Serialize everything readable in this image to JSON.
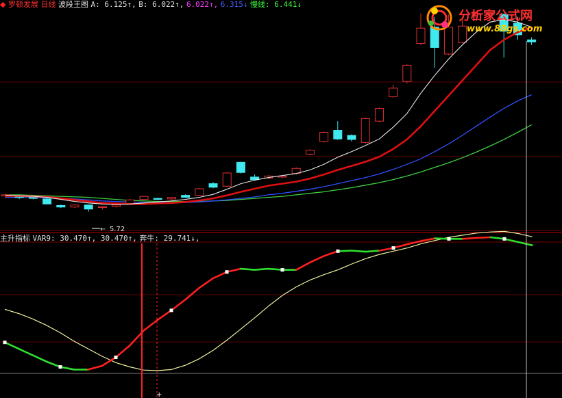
{
  "header_top": {
    "stock": "罗顿发展",
    "period": "日线",
    "indicator": "波段王图",
    "a_text": "A: 6.125↑,",
    "b_text": "B: 6.022↑,",
    "c_text": "6.022↑,",
    "d_text": "6.315↓",
    "slow_label": "慢线: 6.441↓",
    "colors": {
      "stock": "#ff3030",
      "period": "#ff3030",
      "indicator": "#e0e0e0",
      "a": "#e0e0e0",
      "b": "#e0e0e0",
      "c": "#ff40ff",
      "d": "#4060ff",
      "slow": "#40ff40"
    }
  },
  "header_bottom": {
    "title": "主升指标",
    "var9_label": "VAR9: 30.470↑, 30.470↑,",
    "bull_label": "奔牛: 29.741↓,",
    "colors": {
      "title": "#e0e0e0",
      "var9": "#e0e0e0",
      "bull": "#e0e0e0"
    }
  },
  "logo": {
    "text": "分析家公式网",
    "url_text": "www.88gs.com"
  },
  "price_low_label": "5.72",
  "chart_data": [
    {
      "type": "candlestick",
      "title": "波段王图",
      "candles": [
        {
          "o": 6.03,
          "c": 6.05,
          "h": 6.08,
          "l": 5.98,
          "up": true
        },
        {
          "o": 6.01,
          "c": 6.0,
          "h": 6.03,
          "l": 5.97,
          "up": false
        },
        {
          "o": 6.02,
          "c": 5.98,
          "h": 6.03,
          "l": 5.96,
          "up": false
        },
        {
          "o": 5.97,
          "c": 5.87,
          "h": 5.98,
          "l": 5.86,
          "up": false
        },
        {
          "o": 5.84,
          "c": 5.81,
          "h": 5.86,
          "l": 5.79,
          "up": false
        },
        {
          "o": 5.81,
          "c": 5.85,
          "h": 5.86,
          "l": 5.79,
          "up": true
        },
        {
          "o": 5.85,
          "c": 5.77,
          "h": 5.86,
          "l": 5.72,
          "up": false
        },
        {
          "o": 5.8,
          "c": 5.82,
          "h": 5.83,
          "l": 5.76,
          "up": true
        },
        {
          "o": 5.82,
          "c": 5.85,
          "h": 5.86,
          "l": 5.8,
          "up": true
        },
        {
          "o": 5.88,
          "c": 5.95,
          "h": 5.97,
          "l": 5.86,
          "up": true
        },
        {
          "o": 5.96,
          "c": 6.02,
          "h": 6.03,
          "l": 5.95,
          "up": true
        },
        {
          "o": 5.98,
          "c": 5.96,
          "h": 5.99,
          "l": 5.94,
          "up": false
        },
        {
          "o": 5.97,
          "c": 6.0,
          "h": 6.01,
          "l": 5.95,
          "up": true
        },
        {
          "o": 6.04,
          "c": 6.0,
          "h": 6.06,
          "l": 5.99,
          "up": false
        },
        {
          "o": 6.04,
          "c": 6.17,
          "h": 6.18,
          "l": 6.03,
          "up": true
        },
        {
          "o": 6.27,
          "c": 6.2,
          "h": 6.3,
          "l": 6.18,
          "up": false
        },
        {
          "o": 6.22,
          "c": 6.48,
          "h": 6.5,
          "l": 6.2,
          "up": true
        },
        {
          "o": 6.69,
          "c": 6.49,
          "h": 6.7,
          "l": 6.47,
          "up": false
        },
        {
          "o": 6.4,
          "c": 6.35,
          "h": 6.45,
          "l": 6.33,
          "up": false
        },
        {
          "o": 6.38,
          "c": 6.42,
          "h": 6.44,
          "l": 6.36,
          "up": true
        },
        {
          "o": 6.4,
          "c": 6.42,
          "h": 6.44,
          "l": 6.38,
          "up": true
        },
        {
          "o": 6.47,
          "c": 6.57,
          "h": 6.59,
          "l": 6.45,
          "up": true
        },
        {
          "o": 6.85,
          "c": 6.93,
          "h": 6.95,
          "l": 6.83,
          "up": true
        },
        {
          "o": 7.1,
          "c": 7.28,
          "h": 7.3,
          "l": 7.08,
          "up": true
        },
        {
          "o": 7.32,
          "c": 7.15,
          "h": 7.5,
          "l": 7.13,
          "up": false
        },
        {
          "o": 7.22,
          "c": 7.14,
          "h": 7.24,
          "l": 7.1,
          "up": false
        },
        {
          "o": 7.08,
          "c": 7.55,
          "h": 7.57,
          "l": 7.06,
          "up": true
        },
        {
          "o": 7.5,
          "c": 7.75,
          "h": 7.77,
          "l": 7.48,
          "up": true
        },
        {
          "o": 7.98,
          "c": 8.15,
          "h": 8.22,
          "l": 7.96,
          "up": true
        },
        {
          "o": 8.28,
          "c": 8.6,
          "h": 8.62,
          "l": 8.24,
          "up": true
        },
        {
          "o": 9.03,
          "c": 9.33,
          "h": 9.62,
          "l": 9.0,
          "up": true
        },
        {
          "o": 9.35,
          "c": 8.95,
          "h": 9.55,
          "l": 8.55,
          "up": false
        },
        {
          "o": 8.82,
          "c": 9.35,
          "h": 9.6,
          "l": 8.8,
          "up": true
        },
        {
          "o": 9.05,
          "c": 9.37,
          "h": 9.55,
          "l": 9.03,
          "up": true
        },
        {
          "o": 9.5,
          "c": 9.62,
          "h": 9.65,
          "l": 9.48,
          "up": true
        },
        {
          "o": 9.6,
          "c": 9.62,
          "h": 9.64,
          "l": 9.55,
          "up": true
        },
        {
          "o": 9.6,
          "c": 9.27,
          "h": 9.62,
          "l": 8.75,
          "up": false
        },
        {
          "o": 9.43,
          "c": 9.2,
          "h": 9.55,
          "l": 9.1,
          "up": false
        },
        {
          "o": 9.1,
          "c": 9.06,
          "h": 9.15,
          "l": 9.0,
          "up": false
        }
      ],
      "ma_white": [
        6.04,
        6.03,
        6.02,
        6.0,
        5.96,
        5.92,
        5.89,
        5.87,
        5.86,
        5.87,
        5.89,
        5.91,
        5.93,
        5.96,
        6.0,
        6.06,
        6.16,
        6.27,
        6.34,
        6.39,
        6.43,
        6.47,
        6.54,
        6.65,
        6.79,
        6.9,
        7.02,
        7.15,
        7.38,
        7.65,
        8.05,
        8.4,
        8.72,
        9.0,
        9.25,
        9.45,
        9.5,
        9.45,
        9.35
      ],
      "ma_red": [
        6.03,
        6.03,
        6.02,
        6.01,
        5.98,
        5.95,
        5.92,
        5.89,
        5.88,
        5.87,
        5.87,
        5.88,
        5.89,
        5.91,
        5.94,
        5.98,
        6.04,
        6.11,
        6.17,
        6.23,
        6.27,
        6.31,
        6.37,
        6.45,
        6.54,
        6.62,
        6.7,
        6.8,
        6.95,
        7.14,
        7.4,
        7.7,
        8.0,
        8.3,
        8.6,
        8.9,
        9.1,
        9.25,
        9.35
      ],
      "ma_blue": [
        6.0,
        6.0,
        6.0,
        5.99,
        5.98,
        5.97,
        5.95,
        5.93,
        5.92,
        5.91,
        5.9,
        5.9,
        5.9,
        5.9,
        5.91,
        5.93,
        5.95,
        5.98,
        6.01,
        6.05,
        6.08,
        6.12,
        6.16,
        6.21,
        6.27,
        6.33,
        6.39,
        6.46,
        6.55,
        6.65,
        6.76,
        6.9,
        7.05,
        7.22,
        7.4,
        7.58,
        7.75,
        7.9,
        8.02
      ],
      "ma_green": [
        6.05,
        6.05,
        6.04,
        6.03,
        6.02,
        6.01,
        6.0,
        5.98,
        5.96,
        5.94,
        5.93,
        5.92,
        5.92,
        5.92,
        5.92,
        5.93,
        5.94,
        5.96,
        5.98,
        6.0,
        6.02,
        6.05,
        6.08,
        6.11,
        6.15,
        6.19,
        6.24,
        6.29,
        6.35,
        6.42,
        6.5,
        6.59,
        6.68,
        6.78,
        6.89,
        7.01,
        7.14,
        7.28,
        7.43
      ]
    },
    {
      "type": "line",
      "title": "主升指标",
      "var9": [
        21.5,
        20.9,
        20.3,
        19.7,
        19.2,
        18.95,
        18.95,
        19.3,
        20.1,
        21.2,
        22.6,
        23.6,
        24.5,
        25.5,
        26.6,
        27.5,
        28.1,
        28.4,
        28.3,
        28.4,
        28.3,
        28.3,
        29.0,
        29.6,
        30.05,
        30.1,
        30.0,
        30.1,
        30.35,
        30.7,
        31.0,
        31.25,
        31.2,
        31.2,
        31.3,
        31.35,
        31.2,
        30.9,
        30.6
      ],
      "var9_segments": [
        "green",
        "green",
        "green",
        "green",
        "green",
        "green",
        "red",
        "red",
        "red",
        "red",
        "red",
        "red",
        "red",
        "red",
        "red",
        "red",
        "red",
        "green",
        "green",
        "green",
        "green",
        "red",
        "red",
        "red",
        "green",
        "green",
        "green",
        "red",
        "red",
        "red",
        "red",
        "green",
        "green",
        "red",
        "red",
        "green",
        "green",
        "green",
        "green"
      ],
      "bull": [
        24.6,
        24.2,
        23.7,
        23.1,
        22.4,
        21.6,
        20.9,
        20.2,
        19.6,
        19.2,
        18.9,
        18.85,
        18.95,
        19.35,
        19.95,
        20.75,
        21.7,
        22.75,
        23.8,
        24.9,
        25.9,
        26.7,
        27.35,
        27.85,
        28.3,
        28.85,
        29.35,
        29.75,
        30.05,
        30.35,
        30.75,
        31.05,
        31.35,
        31.55,
        31.75,
        31.85,
        31.9,
        31.7,
        31.4
      ]
    }
  ]
}
